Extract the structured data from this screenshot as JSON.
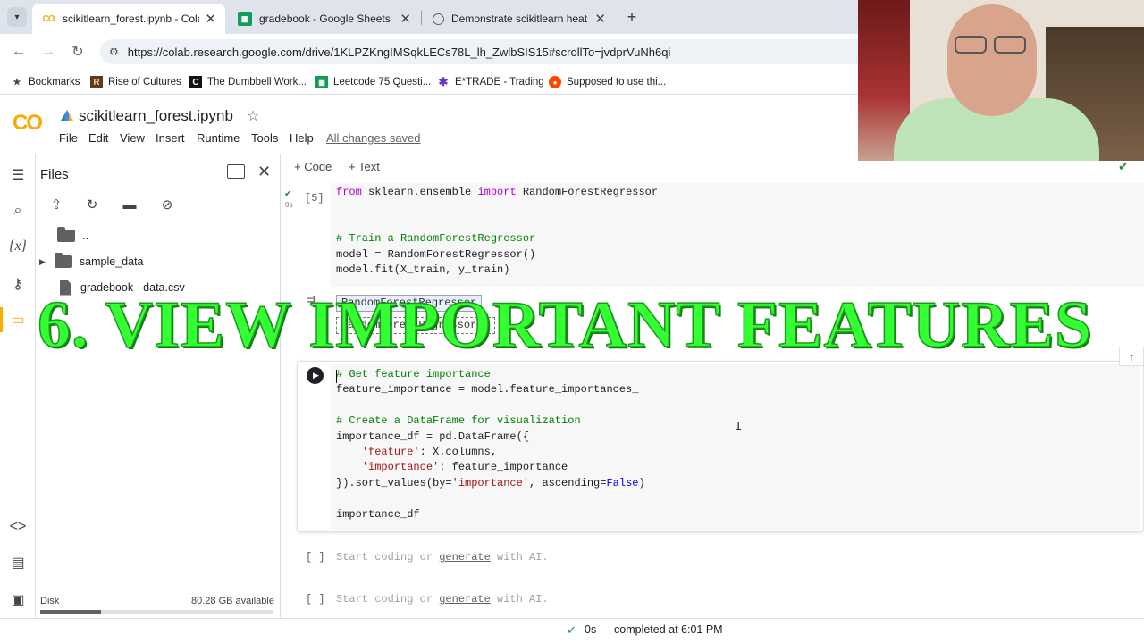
{
  "browser": {
    "tabs": [
      {
        "title": "scikitlearn_forest.ipynb - Colab",
        "favicon": "colab-icon",
        "active": true
      },
      {
        "title": "gradebook - Google Sheets",
        "favicon": "sheets-icon",
        "active": false
      },
      {
        "title": "Demonstrate scikitlearn heat m",
        "favicon": "web-icon",
        "active": false
      }
    ],
    "url": "https://colab.research.google.com/drive/1KLPZKngIMSqkLECs78L_lh_ZwlbSIS15#scrollTo=jvdprVuNh6qi",
    "bookmarks": [
      {
        "label": "Bookmarks",
        "icon": "star-icon"
      },
      {
        "label": "Rise of Cultures",
        "icon": "rise-icon"
      },
      {
        "label": "The Dumbbell Work...",
        "icon": "c-icon"
      },
      {
        "label": "Leetcode 75 Questi...",
        "icon": "sheets-icon"
      },
      {
        "label": "E*TRADE - Trading",
        "icon": "etrade-icon"
      },
      {
        "label": "Supposed to use thi...",
        "icon": "reddit-icon"
      }
    ]
  },
  "colab": {
    "logo": "CO",
    "notebook_title": "scikitlearn_forest.ipynb",
    "menu": [
      "File",
      "Edit",
      "View",
      "Insert",
      "Runtime",
      "Tools",
      "Help"
    ],
    "save_status": "All changes saved",
    "add_code": "+ Code",
    "add_text": "+ Text"
  },
  "files_panel": {
    "title": "Files",
    "entries": [
      {
        "name": "..",
        "type": "folder-up"
      },
      {
        "name": "sample_data",
        "type": "folder"
      },
      {
        "name": "gradebook - data.csv",
        "type": "file"
      }
    ],
    "disk_label": "Disk",
    "disk_available": "80.28 GB available",
    "disk_used_fraction": 0.26
  },
  "cells": {
    "cell1": {
      "exec_count": "[5]",
      "runtime": "0s",
      "lines": [
        "from sklearn.ensemble import RandomForestRegressor",
        "",
        "",
        "# Train a RandomForestRegressor",
        "model = RandomForestRegressor()",
        "model.fit(X_train, y_train)"
      ],
      "output_title": "RandomForestRegressor",
      "output_repr": "RandomForestRegressor()"
    },
    "cell2": {
      "lines": [
        "# Get feature importance",
        "feature_importance = model.feature_importances_",
        "",
        "# Create a DataFrame for visualization",
        "importance_df = pd.DataFrame({",
        "    'feature': X.columns,",
        "    'importance': feature_importance",
        "}).sort_values(by='importance', ascending=False)",
        "",
        "importance_df"
      ]
    },
    "empty_cell_prompt": "[ ]",
    "empty_hint_pre": "Start coding or ",
    "empty_hint_link": "generate",
    "empty_hint_post": " with AI."
  },
  "overlay_caption": "6. VIEW IMPORTANT FEATURES",
  "status": {
    "runtime": "0s",
    "completed": "completed at 6:01 PM"
  },
  "colors": {
    "overlay_green": "#33ff33",
    "colab_orange": "#f9ab00",
    "status_check": "#1e8e3e"
  }
}
